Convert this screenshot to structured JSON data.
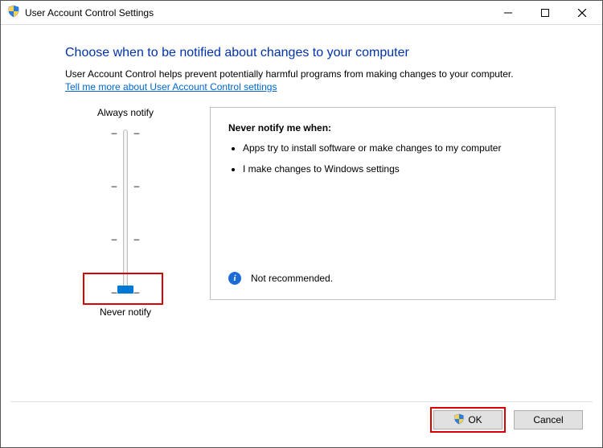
{
  "window": {
    "title": "User Account Control Settings"
  },
  "heading": "Choose when to be notified about changes to your computer",
  "description": "User Account Control helps prevent potentially harmful programs from making changes to your computer.",
  "link_text": "Tell me more about User Account Control settings",
  "slider": {
    "top_label": "Always notify",
    "bottom_label": "Never notify"
  },
  "info": {
    "title": "Never notify me when:",
    "bullet1": "Apps try to install software or make changes to my computer",
    "bullet2": "I make changes to Windows settings",
    "footer": "Not recommended."
  },
  "buttons": {
    "ok": "OK",
    "cancel": "Cancel"
  }
}
